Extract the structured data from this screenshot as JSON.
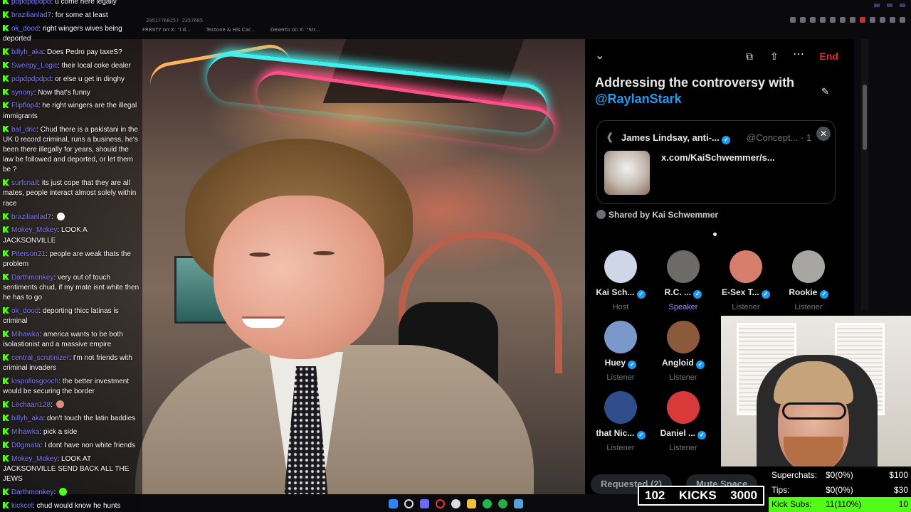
{
  "browser": {
    "url_fragment": "20517768257 2357685",
    "tabs": [
      "FRRSTY on X: \"i d...",
      "Tectone & His Car...",
      "Dexerto on X: \"Str..."
    ]
  },
  "chat": {
    "messages": [
      {
        "user": "pdpdpdpdpd",
        "text": "u come here legally"
      },
      {
        "user": "brazilianlad7",
        "text": "for some at least"
      },
      {
        "user": "ok_dood",
        "text": "right wingers wives being deported"
      },
      {
        "user": "billyh_aka",
        "text": "Does Pedro pay taxeS?"
      },
      {
        "user": "Sweepy_Logic",
        "text": "their local coke dealer"
      },
      {
        "user": "pdpdpdpdpd",
        "text": "or else u get in dinghy"
      },
      {
        "user": "synony",
        "text": "Now that's funny"
      },
      {
        "user": "Flipflop4",
        "text": "he right wingers are the illegal immigrants"
      },
      {
        "user": "bal_dric",
        "text": "Chud there is a pakistani in the UK 0 record criminal, runs a business, he's been there illegally for years, should the law be followed and deported, or let them be ?"
      },
      {
        "user": "surfsnail",
        "text": "its just cope that they are all mates, people interact almost solely within race"
      },
      {
        "user": "brazilianlad7",
        "text": "",
        "emote": "#ffffff"
      },
      {
        "user": "Mokey_Mokey",
        "text": "LOOK A JACKSONVILLE"
      },
      {
        "user": "Piterson21",
        "text": "people are weak thats the problem"
      },
      {
        "user": "Darthmonkey",
        "text": "very out of touch sentiments chud, if my mate isnt white then he has to go"
      },
      {
        "user": "ok_dood",
        "text": "deporting thicc latinas is criminal"
      },
      {
        "user": "Mihawka",
        "text": "america wants to be both isolastionist and a massive empire"
      },
      {
        "user": "central_scrutinizer",
        "text": "I'm not friends with criminal invaders"
      },
      {
        "user": "lospollosgooch",
        "text": "the better investment would be securing the border"
      },
      {
        "user": "Lechaan128",
        "text": "",
        "emote": "#d98f7a"
      },
      {
        "user": "billyh_aka",
        "text": "don't touch the latin baddies"
      },
      {
        "user": "Mihawka",
        "text": "pick a side"
      },
      {
        "user": "D0gmata",
        "text": "I dont have non white friends"
      },
      {
        "user": "Mokey_Mokey",
        "text": "LOOK AT JACKSONVILLE SEND BACK ALL THE JEWS"
      },
      {
        "user": "Darthmonkey",
        "text": "",
        "emote": "#53fc18"
      },
      {
        "user": "kickcel",
        "text": "chud would know he hunts illegals"
      }
    ]
  },
  "space": {
    "end_label": "End",
    "title": "Addressing the controversy with",
    "title_mention": "@RaylanStark",
    "card": {
      "author": "James Lindsay, anti-...",
      "handle": "@Concept... · 1",
      "link": "x.com/KaiSchwemmer/s..."
    },
    "shared_by": "Shared by Kai Schwemmer",
    "participants": [
      {
        "name": "Kai Sch...",
        "role": "Host",
        "color": "#cfd7e6"
      },
      {
        "name": "R.C. ...",
        "role": "Speaker",
        "color": "#6d6b68"
      },
      {
        "name": "E-Sex T...",
        "role": "Listener",
        "color": "#d77d6b"
      },
      {
        "name": "Rookie",
        "role": "Listener",
        "color": "#a8a6a3"
      },
      {
        "name": "Huey",
        "role": "Listener",
        "color": "#7a98c9"
      },
      {
        "name": "Angloid",
        "role": "Listener",
        "color": "#8a5a3a"
      },
      {
        "name": "that Nic...",
        "role": "Listener",
        "color": "#2f4d8a"
      },
      {
        "name": "Daniel ...",
        "role": "Listener",
        "color": "#d83a3a"
      }
    ],
    "requested_label": "Requested (2)",
    "mute_label": "Mute Space"
  },
  "kicks": {
    "left": "102",
    "label": "KICKS",
    "right": "3000"
  },
  "goals": [
    {
      "label": "Superchats:",
      "progress": "$0(0%)",
      "target": "$100"
    },
    {
      "label": "Tips:",
      "progress": "$0(0%)",
      "target": "$30"
    },
    {
      "label": "Kick Subs:",
      "progress": "11(110%)",
      "target": "10"
    }
  ],
  "colors": {
    "kick_green": "#53fc18",
    "x_blue": "#1d9bf0",
    "end_red": "#f4212e",
    "chat_user": "#7d7dff"
  }
}
